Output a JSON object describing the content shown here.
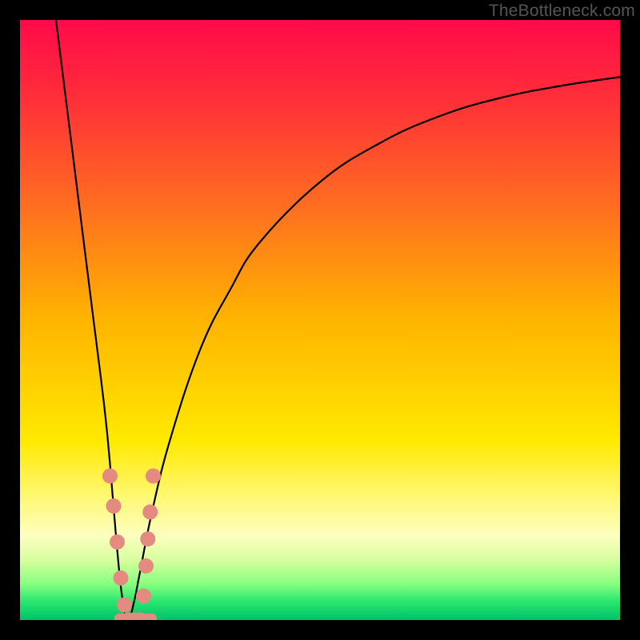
{
  "watermark": "TheBottleneck.com",
  "colors": {
    "frame": "#000000",
    "gradient_stops": [
      {
        "offset": 0.0,
        "color": "#ff0a4a"
      },
      {
        "offset": 0.12,
        "color": "#ff2b3a"
      },
      {
        "offset": 0.3,
        "color": "#ff6a22"
      },
      {
        "offset": 0.5,
        "color": "#ffb400"
      },
      {
        "offset": 0.7,
        "color": "#ffe900"
      },
      {
        "offset": 0.8,
        "color": "#fff97a"
      },
      {
        "offset": 0.86,
        "color": "#fdffc0"
      },
      {
        "offset": 0.9,
        "color": "#d7ff9e"
      },
      {
        "offset": 0.94,
        "color": "#87ff7f"
      },
      {
        "offset": 0.97,
        "color": "#27e66f"
      },
      {
        "offset": 1.0,
        "color": "#00c26a"
      }
    ],
    "curve_stroke": "#000000",
    "marker_fill": "#e58a80",
    "marker_stroke": "#d97a70"
  },
  "chart_data": {
    "type": "line",
    "title": "",
    "xlabel": "",
    "ylabel": "",
    "xlim": [
      0,
      100
    ],
    "ylim": [
      0,
      100
    ],
    "grid": false,
    "series": [
      {
        "name": "bottleneck-curve",
        "x": [
          6,
          8,
          10,
          12,
          14,
          15,
          16,
          17,
          18,
          19,
          20,
          22,
          25,
          30,
          35,
          40,
          50,
          60,
          70,
          80,
          90,
          100
        ],
        "y": [
          100,
          84,
          68,
          52,
          36,
          26,
          14,
          4,
          0,
          3,
          8,
          18,
          30,
          45,
          55,
          63,
          73,
          79.5,
          84,
          87,
          89,
          90.5
        ]
      }
    ],
    "markers": {
      "name": "highlight-dots",
      "points": [
        {
          "x": 15.0,
          "y": 24
        },
        {
          "x": 15.6,
          "y": 19
        },
        {
          "x": 16.2,
          "y": 13
        },
        {
          "x": 16.8,
          "y": 7
        },
        {
          "x": 17.4,
          "y": 2.5
        },
        {
          "x": 18.0,
          "y": 0
        },
        {
          "x": 19.0,
          "y": 0
        },
        {
          "x": 20.0,
          "y": 0
        },
        {
          "x": 20.6,
          "y": 4
        },
        {
          "x": 21.0,
          "y": 9
        },
        {
          "x": 21.3,
          "y": 13.5
        },
        {
          "x": 21.7,
          "y": 18
        },
        {
          "x": 22.2,
          "y": 24
        }
      ],
      "bar_marker": {
        "x1": 16.5,
        "x2": 22.0,
        "y": 0
      }
    }
  }
}
